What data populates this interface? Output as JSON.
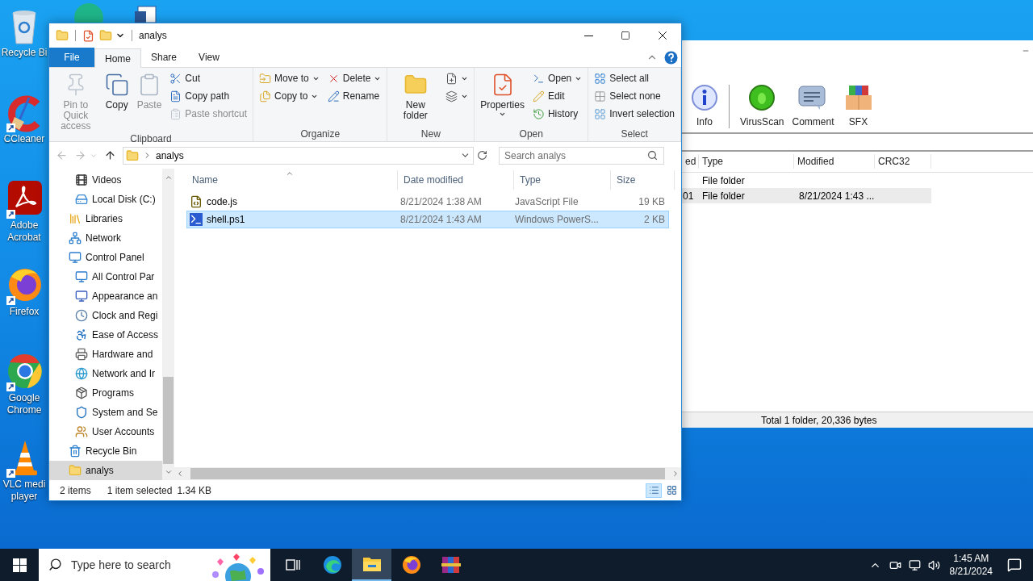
{
  "desktop": {
    "top_icons": [
      {
        "kind": "edge"
      },
      {
        "kind": "doc"
      }
    ],
    "icons": [
      {
        "lines": [
          "Recycle Bi"
        ]
      },
      {
        "lines": [
          "CCleaner"
        ]
      },
      {
        "lines": [
          "Adobe",
          "Acrobat"
        ]
      },
      {
        "lines": [
          "Firefox"
        ]
      },
      {
        "lines": [
          "Google",
          "Chrome"
        ]
      },
      {
        "lines": [
          "VLC medi",
          "player"
        ]
      }
    ]
  },
  "explorer": {
    "title": "analys",
    "tabs": [
      {
        "label": "File",
        "kind": "file",
        "selected": false
      },
      {
        "label": "Home",
        "kind": "tab",
        "selected": true
      },
      {
        "label": "Share",
        "kind": "tab",
        "selected": false
      },
      {
        "label": "View",
        "kind": "tab",
        "selected": false
      }
    ],
    "ribbon": [
      {
        "label": "Clipboard",
        "columns": [
          [
            {
              "kind": "large",
              "label": "Pin to Quick access",
              "disabled": true
            }
          ],
          [
            {
              "kind": "large",
              "label": "Copy",
              "disabled": false
            }
          ],
          [
            {
              "kind": "large",
              "label": "Paste",
              "disabled": true
            }
          ],
          [
            {
              "kind": "small",
              "label": "Cut",
              "disabled": false
            },
            {
              "kind": "small",
              "label": "Copy path",
              "disabled": false
            },
            {
              "kind": "small",
              "label": "Paste shortcut",
              "disabled": true
            }
          ]
        ]
      },
      {
        "label": "Organize",
        "columns": [
          [
            {
              "kind": "small",
              "label": "Move to",
              "disabled": false,
              "dropdown": true
            },
            {
              "kind": "small",
              "label": "Copy to",
              "disabled": false,
              "dropdown": true
            }
          ],
          [
            {
              "kind": "small",
              "label": "Delete",
              "disabled": false,
              "dropdown": true
            },
            {
              "kind": "small",
              "label": "Rename",
              "disabled": false
            }
          ]
        ]
      },
      {
        "label": "New",
        "columns": [
          [
            {
              "kind": "large",
              "label": "New folder",
              "disabled": false
            }
          ],
          [
            {
              "kind": "small",
              "disabled": false,
              "dropdown": true
            },
            {
              "kind": "small",
              "disabled": false,
              "dropdown": true
            }
          ]
        ]
      },
      {
        "label": "Open",
        "columns": [
          [
            {
              "kind": "large",
              "label": "Properties",
              "disabled": false,
              "dropdown": true
            }
          ],
          [
            {
              "kind": "small",
              "label": "Open",
              "disabled": false,
              "dropdown": true
            },
            {
              "kind": "small",
              "label": "Edit",
              "disabled": false
            },
            {
              "kind": "small",
              "label": "History",
              "disabled": false
            }
          ]
        ]
      },
      {
        "label": "Select",
        "columns": [
          [
            {
              "kind": "small",
              "label": "Select all",
              "disabled": false
            },
            {
              "kind": "small",
              "label": "Select none",
              "disabled": false
            },
            {
              "kind": "small",
              "label": "Invert selection",
              "disabled": false
            }
          ]
        ]
      }
    ],
    "address": "analys",
    "search": {
      "placeholder": "Search analys"
    },
    "nav": [
      {
        "children": [
          {
            "label": "Videos",
            "selected": false
          },
          {
            "label": "Local Disk (C:)",
            "selected": false
          }
        ]
      },
      {
        "label": "Libraries",
        "selected": false
      },
      {
        "label": "Network",
        "selected": false
      },
      {
        "label": "Control Panel",
        "selected": false,
        "children": [
          {
            "label": "All Control Par",
            "selected": false
          },
          {
            "label": "Appearance an",
            "selected": false
          },
          {
            "label": "Clock and Regi",
            "selected": false
          },
          {
            "label": "Ease of Access",
            "selected": false
          },
          {
            "label": "Hardware and",
            "selected": false
          },
          {
            "label": "Network and Ir",
            "selected": false
          },
          {
            "label": "Programs",
            "selected": false
          },
          {
            "label": "System and Se",
            "selected": false
          },
          {
            "label": "User Accounts",
            "selected": false
          }
        ]
      },
      {
        "label": "Recycle Bin",
        "selected": false
      },
      {
        "label": "analys",
        "selected": true
      }
    ],
    "columns": [
      "Name",
      "Date modified",
      "Type",
      "Size"
    ],
    "rows": [
      {
        "name": "code.js",
        "date": "8/21/2024 1:38 AM",
        "type": "JavaScript File",
        "size": "19 KB",
        "selected": false
      },
      {
        "name": "shell.ps1",
        "date": "8/21/2024 1:43 AM",
        "type": "Windows PowerS...",
        "size": "2 KB",
        "selected": true
      }
    ],
    "status": {
      "count": "2 items",
      "selection": "1 item selected",
      "size": "1.34 KB"
    },
    "views": [
      {
        "selected": true
      },
      {
        "selected": false
      }
    ]
  },
  "winrar": {
    "toolbar": [
      "Info",
      "VirusScan",
      "Comment",
      "SFX"
    ],
    "columns": [
      "ed",
      "Type",
      "Modified",
      "CRC32"
    ],
    "rows": [
      {
        "column_1": "",
        "type": "File folder",
        "modified": "",
        "selected": false
      },
      {
        "column_1": "01",
        "type": "File folder",
        "modified": "8/21/2024 1:43 ...",
        "selected": true
      }
    ],
    "status": "Total 1 folder, 20,336 bytes"
  },
  "taskbar": {
    "search": {
      "placeholder": "Type here to search"
    },
    "apps": [
      {
        "selected": false
      },
      {
        "selected": false
      },
      {
        "selected": true
      },
      {
        "selected": false
      },
      {
        "selected": false
      }
    ],
    "time": "1:45 AM",
    "date": "8/21/2024"
  }
}
